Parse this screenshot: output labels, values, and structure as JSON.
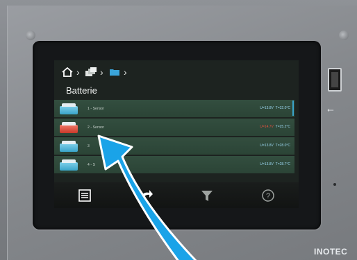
{
  "breadcrumb": {
    "home_icon": "home-icon",
    "devices_icon": "devices-icon",
    "folder_icon": "folder-icon"
  },
  "page": {
    "title": "Batterie"
  },
  "rows": [
    {
      "label": "1 - Sensor",
      "voltage": "U=13.8V",
      "temp": "T=32.0°C",
      "state": "ok"
    },
    {
      "label": "2 - Sensor",
      "voltage": "U=14.7V",
      "temp": "T=25.2°C",
      "state": "warn"
    },
    {
      "label": "3",
      "voltage": "U=13.8V",
      "temp": "T=28.0°C",
      "state": "ok"
    },
    {
      "label": "4 - S",
      "voltage": "U=13.8V",
      "temp": "T=28.7°C",
      "state": "ok"
    }
  ],
  "toolbar": {
    "menu_icon": "menu-icon",
    "back_icon": "back-icon",
    "filter_icon": "filter-icon",
    "help_icon": "help-icon"
  },
  "device": {
    "brand": "INOTEC",
    "usb_icon": "usb-icon"
  },
  "colors": {
    "ok_battery": "#3aa4c9",
    "warn_battery": "#c9392a",
    "arrow": "#1aa3e8",
    "row_bg": "#2b4436"
  }
}
